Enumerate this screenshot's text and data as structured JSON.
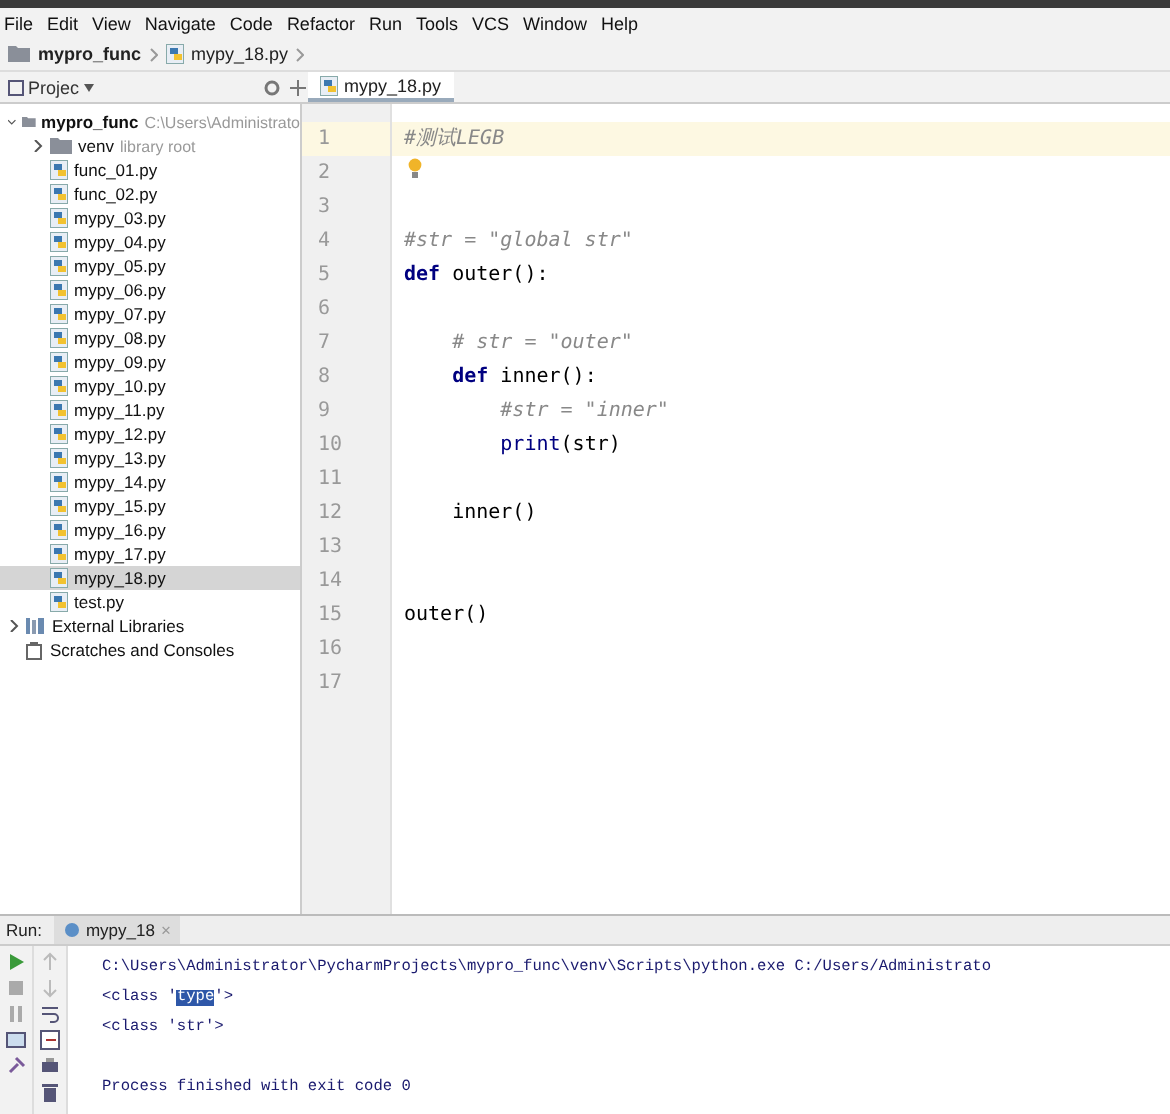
{
  "menu": [
    "File",
    "Edit",
    "View",
    "Navigate",
    "Code",
    "Refactor",
    "Run",
    "Tools",
    "VCS",
    "Window",
    "Help"
  ],
  "breadcrumb": [
    "mypro_func",
    "mypy_18.py"
  ],
  "project_tool": {
    "label": "Projec"
  },
  "editor_tab": {
    "label": "mypy_18.py",
    "selected": true
  },
  "tree": [
    {
      "name": "mypro_func",
      "hint": "C:\\Users\\Administrato",
      "kind": "folder",
      "expanded": true,
      "selected": false,
      "children": [
        {
          "name": "venv",
          "hint": "library root",
          "kind": "folder",
          "expanded": false,
          "selected": false
        },
        {
          "name": "func_01.py",
          "kind": "file",
          "selected": false
        },
        {
          "name": "func_02.py",
          "kind": "file",
          "selected": false
        },
        {
          "name": "mypy_03.py",
          "kind": "file",
          "selected": false
        },
        {
          "name": "mypy_04.py",
          "kind": "file",
          "selected": false
        },
        {
          "name": "mypy_05.py",
          "kind": "file",
          "selected": false
        },
        {
          "name": "mypy_06.py",
          "kind": "file",
          "selected": false
        },
        {
          "name": "mypy_07.py",
          "kind": "file",
          "selected": false
        },
        {
          "name": "mypy_08.py",
          "kind": "file",
          "selected": false
        },
        {
          "name": "mypy_09.py",
          "kind": "file",
          "selected": false
        },
        {
          "name": "mypy_10.py",
          "kind": "file",
          "selected": false
        },
        {
          "name": "mypy_11.py",
          "kind": "file",
          "selected": false
        },
        {
          "name": "mypy_12.py",
          "kind": "file",
          "selected": false
        },
        {
          "name": "mypy_13.py",
          "kind": "file",
          "selected": false
        },
        {
          "name": "mypy_14.py",
          "kind": "file",
          "selected": false
        },
        {
          "name": "mypy_15.py",
          "kind": "file",
          "selected": false
        },
        {
          "name": "mypy_16.py",
          "kind": "file",
          "selected": false
        },
        {
          "name": "mypy_17.py",
          "kind": "file",
          "selected": false
        },
        {
          "name": "mypy_18.py",
          "kind": "file",
          "selected": true
        },
        {
          "name": "test.py",
          "kind": "file",
          "selected": false
        }
      ]
    },
    {
      "name": "External Libraries",
      "kind": "library",
      "expanded": false,
      "selected": false
    },
    {
      "name": "Scratches and Consoles",
      "kind": "scratch",
      "selected": false
    }
  ],
  "code_lines": [
    {
      "number": "1",
      "current": true,
      "tokens": [
        {
          "kind": "comment",
          "text": "#测试LEGB"
        }
      ]
    },
    {
      "number": "2",
      "current": false
    },
    {
      "number": "3",
      "current": false
    },
    {
      "number": "4",
      "current": false,
      "tokens": [
        {
          "kind": "comment",
          "text": "#str = \"global str\""
        }
      ]
    },
    {
      "number": "5",
      "current": false,
      "tokens": [
        {
          "kind": "keyword",
          "text": "def"
        },
        {
          "kind": "plain",
          "text": " outer():"
        }
      ]
    },
    {
      "number": "6",
      "current": false
    },
    {
      "number": "7",
      "current": false,
      "tokens": [
        {
          "kind": "comment",
          "text": "    # str = \"outer\""
        }
      ]
    },
    {
      "number": "8",
      "current": false,
      "tokens": [
        {
          "kind": "keyword",
          "text": "    def"
        },
        {
          "kind": "plain",
          "text": " inner():"
        }
      ]
    },
    {
      "number": "9",
      "current": false,
      "tokens": [
        {
          "kind": "comment",
          "text": "        #str = \"inner\""
        }
      ]
    },
    {
      "number": "10",
      "current": false,
      "tokens": [
        {
          "kind": "builtin",
          "text": "        print"
        },
        {
          "kind": "plain",
          "text": "(str)"
        }
      ]
    },
    {
      "number": "11",
      "current": false
    },
    {
      "number": "12",
      "current": false,
      "tokens": [
        {
          "kind": "plain",
          "text": "    inner()"
        }
      ]
    },
    {
      "number": "13",
      "current": false
    },
    {
      "number": "14",
      "current": false
    },
    {
      "number": "15",
      "current": false,
      "tokens": [
        {
          "kind": "plain",
          "text": "outer()"
        }
      ]
    },
    {
      "number": "16",
      "current": false
    },
    {
      "number": "17",
      "current": false
    }
  ],
  "run": {
    "label": "Run:",
    "tab": {
      "label": "mypy_18",
      "close": "×",
      "selected": true
    },
    "output": [
      {
        "parts": [
          {
            "text": "C:\\Users\\Administrator\\PycharmProjects\\mypro_func\\venv\\Scripts\\python.exe C:/Users/Administrato",
            "selected": false
          }
        ]
      },
      {
        "parts": [
          {
            "text": "<class '",
            "selected": false
          },
          {
            "text": "type",
            "selected": true
          },
          {
            "text": "'>",
            "selected": false
          }
        ]
      },
      {
        "parts": [
          {
            "text": "<class 'str'>",
            "selected": false
          }
        ]
      },
      {
        "kind": "status",
        "parts": [
          {
            "text": "Process finished with exit code 0",
            "selected": false
          }
        ]
      }
    ]
  }
}
